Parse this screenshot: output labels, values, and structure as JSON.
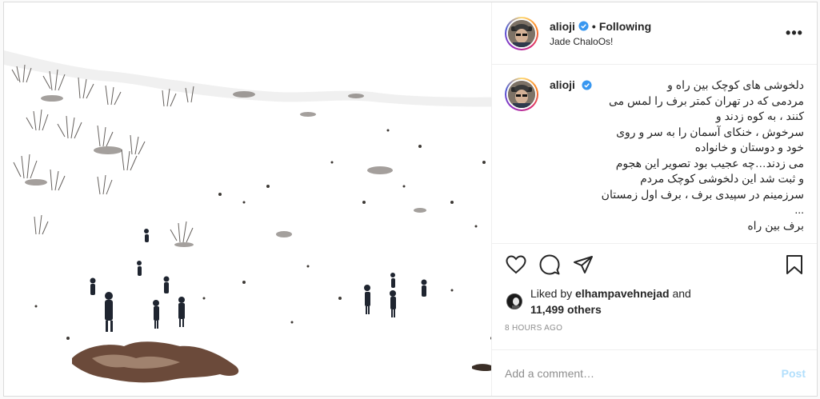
{
  "post": {
    "username": "alioji",
    "follow_status": "Following",
    "dot": "•",
    "location": "Jade ChaloOs!",
    "more_label": "•••",
    "caption_lines": [
      "دلخوشی های کوچک بین راه و",
      "مردمی که در تهران کمتر برف را لمس می",
      "کنند ، به کوه زدند و",
      "سرخوش ، خنکای آسمان را به سر و روی",
      "خود و دوستان و خانواده",
      "می زدند…چه عجیب بود تصویر این هجوم",
      "و ثبت شد این دلخوشی کوچک مردم",
      "سرزمینم در سپیدی برف ، برف اول زمستان",
      "...",
      "برف بین راه"
    ],
    "likes_prefix": "Liked by",
    "liked_by_user": "elhampavehnejad",
    "likes_and": "and",
    "likes_others": "11,499 others",
    "time_ago": "8 HOURS AGO",
    "comment_placeholder": "Add a comment…",
    "post_button": "Post"
  },
  "icons": {
    "verified": "verified-badge-icon",
    "like": "heart-icon",
    "comment": "comment-bubble-icon",
    "share": "paper-plane-icon",
    "save": "bookmark-icon",
    "more": "more-options-icon"
  },
  "colors": {
    "verified_blue": "#3897f0",
    "post_button_disabled": "#b2dffc",
    "muted_text": "#8e8e8e",
    "border": "#dbdbdb"
  }
}
